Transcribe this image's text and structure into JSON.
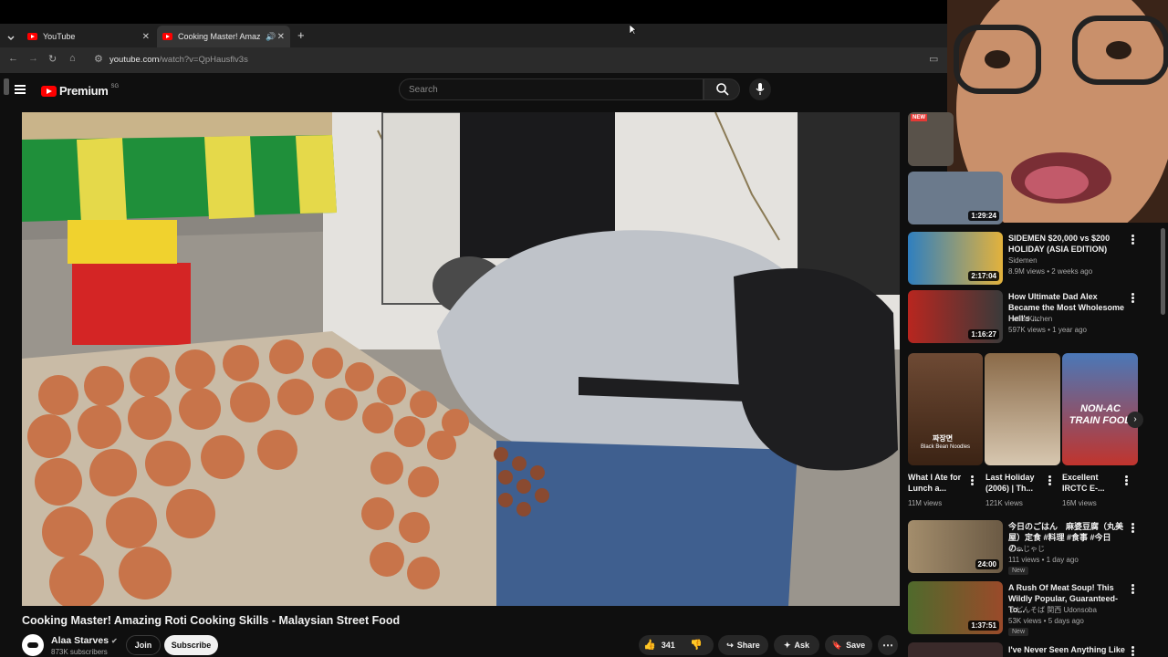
{
  "browser": {
    "tabs": [
      {
        "label": "YouTube"
      },
      {
        "label": "Cooking Master! Amazing R"
      }
    ],
    "new_tab": "+",
    "url_host": "youtube.com",
    "url_path": "/watch?v=QpHausflv3s"
  },
  "header": {
    "logo_text": "Premium",
    "region": "SG",
    "search_placeholder": "Search"
  },
  "video": {
    "title": "Cooking Master! Amazing Roti Cooking Skills - Malaysian Street Food",
    "channel": "Alaa Starves",
    "subscribers": "873K subscribers",
    "join_label": "Join",
    "subscribe_label": "Subscribe",
    "like_count": "341",
    "share_label": "Share",
    "ask_label": "Ask",
    "save_label": "Save"
  },
  "recommended": [
    {
      "title": "",
      "duration": "",
      "badge": "NEW"
    },
    {
      "title": "",
      "duration": "1:29:24"
    },
    {
      "title": "SIDEMEN $20,000 vs $200 HOLIDAY (ASIA EDITION)",
      "channel": "Sidemen",
      "meta": "8.9M views • 2 weeks ago",
      "duration": "2:17:04"
    },
    {
      "title": "How Ultimate Dad Alex Became the Most Wholesome Hell's ...",
      "channel": "Hell's Kitchen",
      "meta": "597K views • 1 year ago",
      "duration": "1:16:27"
    }
  ],
  "shorts": [
    {
      "title": "What I Ate for Lunch a...",
      "views": "11M views",
      "caption": "짜장면",
      "subcaption": "Black Bean Noodles"
    },
    {
      "title": "Last Holiday (2006) | Th...",
      "views": "121K views"
    },
    {
      "title": "Excellent IRCTC E-...",
      "views": "16M views",
      "caption": "NON-AC TRAIN FOOD"
    }
  ],
  "recommended2": [
    {
      "title": "今日のごはん　麻婆豆腐（丸美屋）定食 #料理 #食事 #今日の...",
      "channel": "じゃじゃじ",
      "meta": "111 views • 1 day ago",
      "duration": "24:00",
      "badge": "New"
    },
    {
      "title": "A Rush Of Meat Soup! This Wildly Popular, Guaranteed-To...",
      "channel": "うどんそば 関西 Udonsoba",
      "meta": "53K views • 5 days ago",
      "duration": "1:37:51",
      "badge": "New"
    },
    {
      "title": "I've Never Seen Anything Like"
    }
  ],
  "colors": {
    "accent": "#ff0000",
    "bg": "#0f0f0f"
  }
}
